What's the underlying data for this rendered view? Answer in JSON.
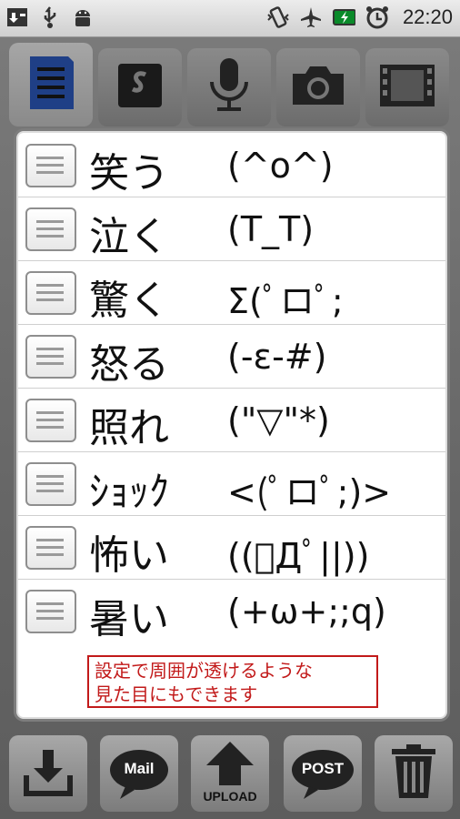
{
  "status_bar": {
    "time": "22:20",
    "left_icons": [
      "download-icon",
      "usb-icon",
      "android-icon"
    ],
    "right_icons": [
      "vibrate-icon",
      "airplane-icon",
      "battery-charging-icon",
      "alarm-icon"
    ]
  },
  "tabs": [
    {
      "icon": "note-icon",
      "active": true
    },
    {
      "icon": "evernote-icon",
      "active": false
    },
    {
      "icon": "microphone-icon",
      "active": false
    },
    {
      "icon": "camera-icon",
      "active": false
    },
    {
      "icon": "film-icon",
      "active": false
    }
  ],
  "items": [
    {
      "name": "笑う",
      "emoticon": "(^o^)"
    },
    {
      "name": "泣く",
      "emoticon": "(T_T)"
    },
    {
      "name": "驚く",
      "emoticon": "Σ(ﾟロﾟ;"
    },
    {
      "name": "怒る",
      "emoticon": "(-ε-#)"
    },
    {
      "name": "照れ",
      "emoticon": "(\"▽\"*)"
    },
    {
      "name": "ｼｮｯｸ",
      "emoticon": "<(ﾟロﾟ;)>"
    },
    {
      "name": "怖い",
      "emoticon": "((ﾟДﾟ||))"
    },
    {
      "name": "暑い",
      "emoticon": "(+ω+;;q)"
    }
  ],
  "note": {
    "line1": "設定で周囲が透けるような",
    "line2": "見た目にもできます"
  },
  "bottom_bar": {
    "mail_label": "Mail",
    "upload_label": "UPLOAD",
    "post_label": "POST",
    "icons": [
      "download-icon",
      "mail-icon",
      "upload-icon",
      "post-icon",
      "trash-icon"
    ]
  },
  "colors": {
    "note_red": "#c21a1a",
    "active_tab_icon": "#2a4a8c"
  }
}
